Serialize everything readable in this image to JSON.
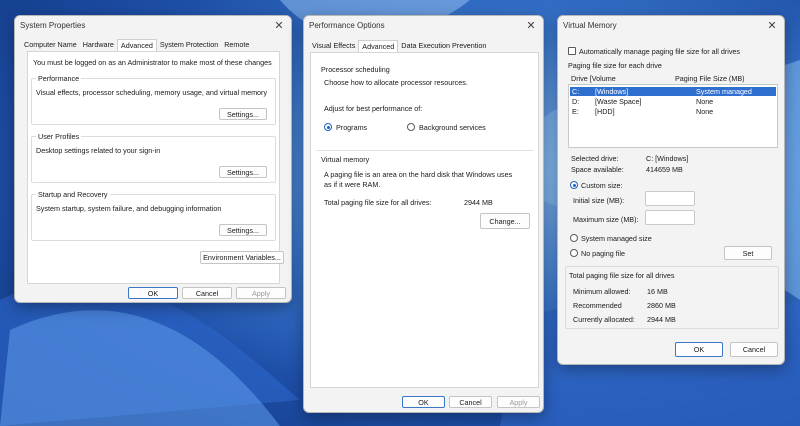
{
  "colors": {
    "accent": "#2f6fd0",
    "window_bg": "#f3f3f3"
  },
  "icons": {
    "close": "close-icon"
  },
  "system_properties": {
    "title": "System Properties",
    "tabs": [
      "Computer Name",
      "Hardware",
      "Advanced",
      "System Protection",
      "Remote"
    ],
    "active_tab": "Advanced",
    "admin_note": "You must be logged on as an Administrator to make most of these changes",
    "performance": {
      "label": "Performance",
      "desc": "Visual effects, processor scheduling, memory usage, and virtual memory",
      "button": "Settings..."
    },
    "user_profiles": {
      "label": "User Profiles",
      "desc": "Desktop settings related to your sign-in",
      "button": "Settings..."
    },
    "startup": {
      "label": "Startup and Recovery",
      "desc": "System startup, system failure, and debugging information",
      "button": "Settings..."
    },
    "env_button": "Environment Variables...",
    "ok": "OK",
    "cancel": "Cancel",
    "apply": "Apply"
  },
  "performance_options": {
    "title": "Performance Options",
    "tabs": [
      "Visual Effects",
      "Advanced",
      "Data Execution Prevention"
    ],
    "active_tab": "Advanced",
    "processor": {
      "label": "Processor scheduling",
      "desc": "Choose how to allocate processor resources.",
      "adjust": "Adjust for best performance of:",
      "programs": "Programs",
      "background": "Background services",
      "selected": "Programs"
    },
    "virtual_memory": {
      "label": "Virtual memory",
      "desc_line1": "A paging file is an area on the hard disk that Windows uses",
      "desc_line2": "as if it were RAM.",
      "total_label": "Total paging file size for all drives:",
      "total_value": "2944 MB",
      "change_button": "Change..."
    },
    "ok": "OK",
    "cancel": "Cancel",
    "apply": "Apply"
  },
  "virtual_memory": {
    "title": "Virtual Memory",
    "auto_manage": "Automatically manage paging file size for all drives",
    "auto_manage_checked": false,
    "paging_label": "Paging file size for each drive",
    "headers": {
      "drive": "Drive  [Volume",
      "size": "Paging File Size (MB)"
    },
    "drives": [
      {
        "drive": "C:",
        "volume": "[Windows]",
        "size": "System managed",
        "selected": true
      },
      {
        "drive": "D:",
        "volume": "[Waste Space]",
        "size": "None",
        "selected": false
      },
      {
        "drive": "E:",
        "volume": "[HDD]",
        "size": "None",
        "selected": false
      }
    ],
    "selected_drive_label": "Selected drive:",
    "selected_drive_value": "C:  [Windows]",
    "space_label": "Space available:",
    "space_value": "414659 MB",
    "custom_size": "Custom size:",
    "initial_label": "Initial size (MB):",
    "initial_value": "",
    "max_label": "Maximum size (MB):",
    "max_value": "",
    "system_managed": "System managed size",
    "no_paging": "No paging file",
    "selected_option": "Custom size:",
    "set_button": "Set",
    "totals_label": "Total paging file size for all drives",
    "min_label": "Minimum allowed:",
    "min_value": "16 MB",
    "rec_label": "Recommended",
    "rec_value": "2860 MB",
    "cur_label": "Currently allocated:",
    "cur_value": "2944 MB",
    "ok": "OK",
    "cancel": "Cancel"
  }
}
